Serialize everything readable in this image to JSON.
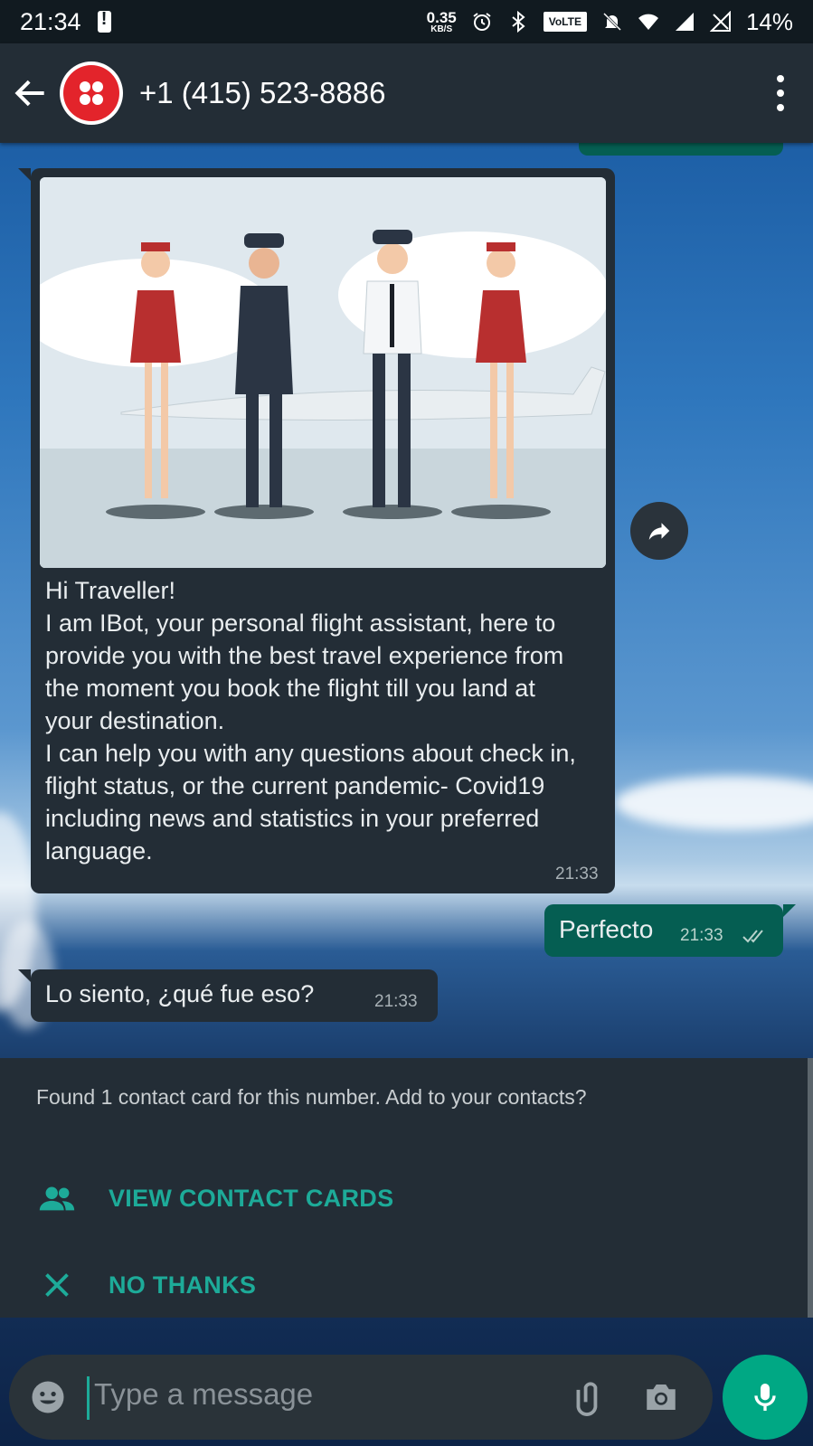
{
  "status_bar": {
    "time": "21:34",
    "net_speed_value": "0.35",
    "net_speed_unit": "KB/S",
    "volte": "VoLTE",
    "battery": "14%"
  },
  "header": {
    "contact": "+1 (415) 523-8886"
  },
  "messages": [
    {
      "direction": "in",
      "has_image": true,
      "text": "Hi Traveller!\n I am IBot, your personal flight assistant, here to provide you with the best travel experience from the moment you book the flight till you land at your destination.\n I can help you with any questions about check in, flight status, or the current pandemic- Covid19 including news and statistics in your preferred language.",
      "time": "21:33"
    },
    {
      "direction": "out",
      "text": "Perfecto",
      "time": "21:33",
      "status": "read"
    },
    {
      "direction": "in",
      "text": "Lo siento, ¿qué fue eso?",
      "time": "21:33"
    }
  ],
  "contact_card_prompt": {
    "message": "Found 1 contact card for this number. Add to your contacts?",
    "view_label": "VIEW CONTACT CARDS",
    "dismiss_label": "NO THANKS"
  },
  "composer": {
    "placeholder": "Type a message"
  },
  "colors": {
    "accent": "#1dab99",
    "outgoing_bubble": "#055e52",
    "incoming_bubble": "#232d36",
    "avatar": "#e3242b",
    "mic_button": "#00a884"
  }
}
